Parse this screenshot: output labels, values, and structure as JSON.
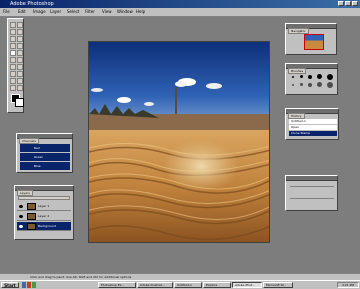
{
  "window": {
    "title": "Adobe Photoshop"
  },
  "menu": [
    "File",
    "Edit",
    "Image",
    "Layer",
    "Select",
    "Filter",
    "View",
    "Window",
    "Help"
  ],
  "panels": {
    "navigator": {
      "tab": "Navigator"
    },
    "brushes": {
      "tab": "Brushes"
    },
    "history": {
      "tab": "History",
      "items": [
        "Untitled-1",
        "Open",
        "Clone Stamp"
      ]
    },
    "channels": {
      "tab": "Channels",
      "items": [
        "Red",
        "Green",
        "Blue"
      ]
    },
    "layers": {
      "tab": "Layers",
      "items": [
        "Layer 1",
        "Layer 2",
        "Background"
      ]
    }
  },
  "status": {
    "text": "Click and drag to paint. Use Alt, Shift and Ctrl for additional options."
  },
  "taskbar": {
    "start": "Start",
    "items": [
      "Photoshop Ex...",
      "Adobe Illustrat...",
      "Untitled-1",
      "Explore",
      "Adobe Phot...",
      "Microsoft W..."
    ],
    "active_index": 4,
    "clock": "3:21 PM"
  },
  "colors": {
    "desktop": "#7d7d7d",
    "titlebar": "#0a246a",
    "selection": "#0a246a",
    "sky": "#2a5aa8",
    "sand": "#c88a40"
  }
}
